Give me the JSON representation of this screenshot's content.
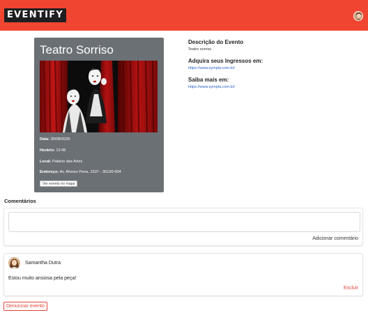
{
  "header": {
    "logo_text": "EVENTIFY",
    "brand_color": "#f04531",
    "avatar_icon": "user-avatar"
  },
  "event": {
    "title": "Teatro Sorriso",
    "date_label": "Data:",
    "date_value": "30/08/2025",
    "time_label": "Horário:",
    "time_value": "12:45",
    "place_label": "Local:",
    "place_value": "Palácio das Artes",
    "address_label": "Endereço:",
    "address_value": "Av. Afonso Pena, 1537 - 30130-004",
    "map_button": "Ver evento no mapa",
    "image_icon": "theatre-mime-photo"
  },
  "details": {
    "description_heading": "Descrição do Evento",
    "description_text": "Teatro sorriso",
    "tickets_heading": "Adquira seus Ingressos em:",
    "tickets_link": "https://www.sympla.com.br/",
    "more_heading": "Saiba mais em:",
    "more_link": "https://www.sympla.com.br/"
  },
  "comments": {
    "title": "Comentários",
    "input_value": "",
    "input_placeholder": "",
    "add_button": "Adicionar comentário",
    "items": [
      {
        "author": "Samantha Dutra",
        "text": "Estou muito ansiosa pela peça!",
        "delete_label": "Excluir"
      }
    ]
  },
  "report_button": "Denunciar evento",
  "colors": {
    "card_bg": "#6b7075",
    "link": "#2a5fc4",
    "danger": "#e0453a"
  }
}
